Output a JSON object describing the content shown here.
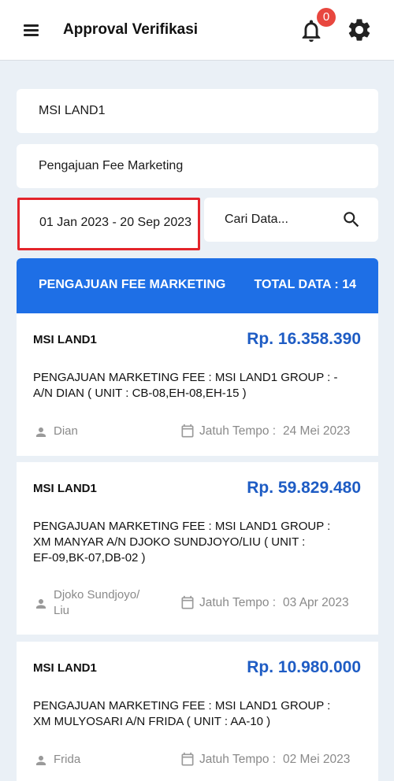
{
  "appbar": {
    "title": "Approval Verifikasi",
    "notification_count": "0"
  },
  "filters": {
    "company": "MSI LAND1",
    "type": "Pengajuan Fee Marketing",
    "date_range": "01 Jan 2023 - 20 Sep 2023",
    "search_placeholder": "Cari Data..."
  },
  "list_header": {
    "title": "PENGAJUAN FEE MARKETING",
    "total": "TOTAL DATA : 14"
  },
  "due_label": "Jatuh Tempo :",
  "items": [
    {
      "company": "MSI LAND1",
      "amount": "Rp. 16.358.390",
      "desc_line1": "PENGAJUAN MARKETING FEE : MSI LAND1 GROUP : -",
      "desc_line2": "A/N DIAN ( UNIT : CB-08,EH-08,EH-15 )",
      "desc_line3": "",
      "user_line1": "Dian",
      "user_line2": "",
      "due_date": "24 Mei 2023"
    },
    {
      "company": "MSI LAND1",
      "amount": "Rp. 59.829.480",
      "desc_line1": "PENGAJUAN MARKETING FEE : MSI LAND1 GROUP :",
      "desc_line2": "XM MANYAR A/N DJOKO SUNDJOYO/LIU ( UNIT :",
      "desc_line3": "EF-09,BK-07,DB-02 )",
      "user_line1": "Djoko Sundjoyo/",
      "user_line2": "Liu",
      "due_date": "03 Apr 2023"
    },
    {
      "company": "MSI LAND1",
      "amount": "Rp. 10.980.000",
      "desc_line1": "PENGAJUAN MARKETING FEE : MSI LAND1 GROUP :",
      "desc_line2": "XM MULYOSARI A/N FRIDA ( UNIT : AA-10 )",
      "desc_line3": "",
      "user_line1": "Frida",
      "user_line2": "",
      "due_date": "02 Mei 2023"
    }
  ],
  "colors": {
    "accent": "#1e6fe6",
    "amount": "#1e5cc4",
    "badge": "#e8473f",
    "highlight_border": "#e3242b",
    "background": "#eaf0f6"
  },
  "icons": [
    "menu-icon",
    "bell-icon",
    "gear-icon",
    "search-icon",
    "person-icon",
    "calendar-icon"
  ]
}
